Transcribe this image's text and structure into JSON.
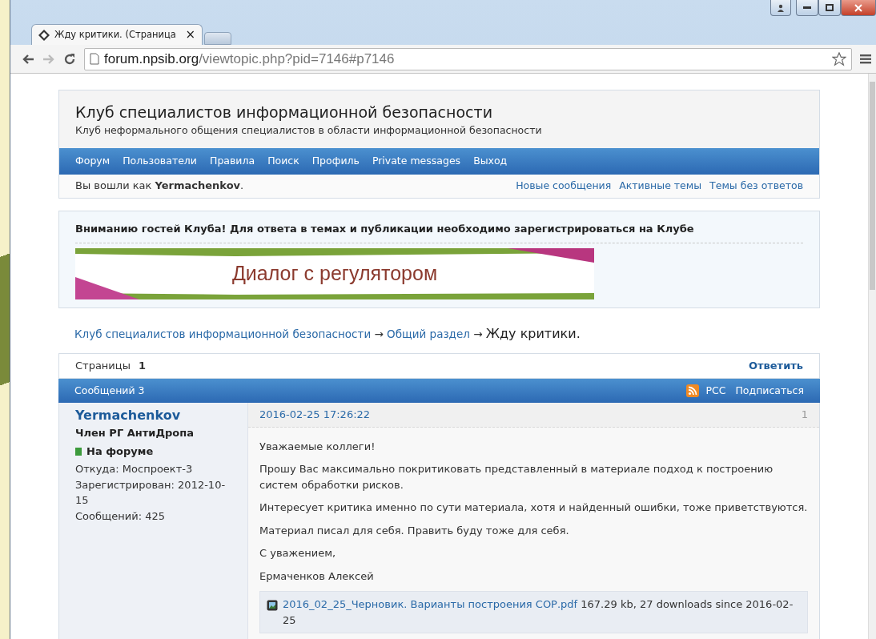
{
  "browser": {
    "tab_title": "Жду критики. (Страница",
    "close": "×",
    "url_host": "forum.npsib.org",
    "url_path": "/viewtopic.php?pid=7146#p7146"
  },
  "header": {
    "title": "Клуб специалистов информационной безопасности",
    "subtitle": "Клуб неформального общения специалистов в области информационной безопасности",
    "nav": [
      "Форум",
      "Пользователи",
      "Правила",
      "Поиск",
      "Профиль",
      "Private messages",
      "Выход"
    ],
    "login": "Вы вошли как **Yermachenkov**.",
    "quick_links": [
      "Новые сообщения",
      "Активные темы",
      "Темы без ответов"
    ]
  },
  "announcement": {
    "text": "Вниманию гостей Клуба! Для ответа в темах и публикации необходимо зарегистрироваться на Клубе",
    "banner_text": "Диалог с регулятором"
  },
  "breadcrumbs": {
    "links": [
      "Клуб специалистов информационной безопасности",
      "Общий раздел"
    ],
    "separator": "→",
    "current": "Жду критики."
  },
  "pages": {
    "label": "Страницы",
    "number": "1",
    "reply": "Ответить"
  },
  "posts_bar": {
    "count": "Сообщений 3",
    "rss": "РСС",
    "subscribe": "Подписаться"
  },
  "post": {
    "author": "Yermachenkov",
    "rank": "Член РГ АнтиДропа",
    "status": "На форуме",
    "online": true,
    "info": [
      "Откуда: Моспроект-3",
      "Зарегистрирован: 2012-10-15",
      "Сообщений: 425"
    ],
    "date": "2016-02-25 17:26:22",
    "number": "1",
    "paragraphs": [
      "Уважаемые коллеги!",
      "Прошу Вас максимально покритиковать представленный в материале подход к построению систем обработки рисков.",
      "Интересует критика именно по сути материала, хотя и найденный ошибки, тоже приветствуются.",
      "Материал писал для себя. Править буду тоже для себя.",
      "С уважением,",
      "Ермаченков Алексей"
    ],
    "attachment": {
      "name": "2016_02_25_Черновик. Варианты построения СОР.pdf",
      "info": "167.29 kb, 27 downloads since 2016-02-25"
    }
  }
}
